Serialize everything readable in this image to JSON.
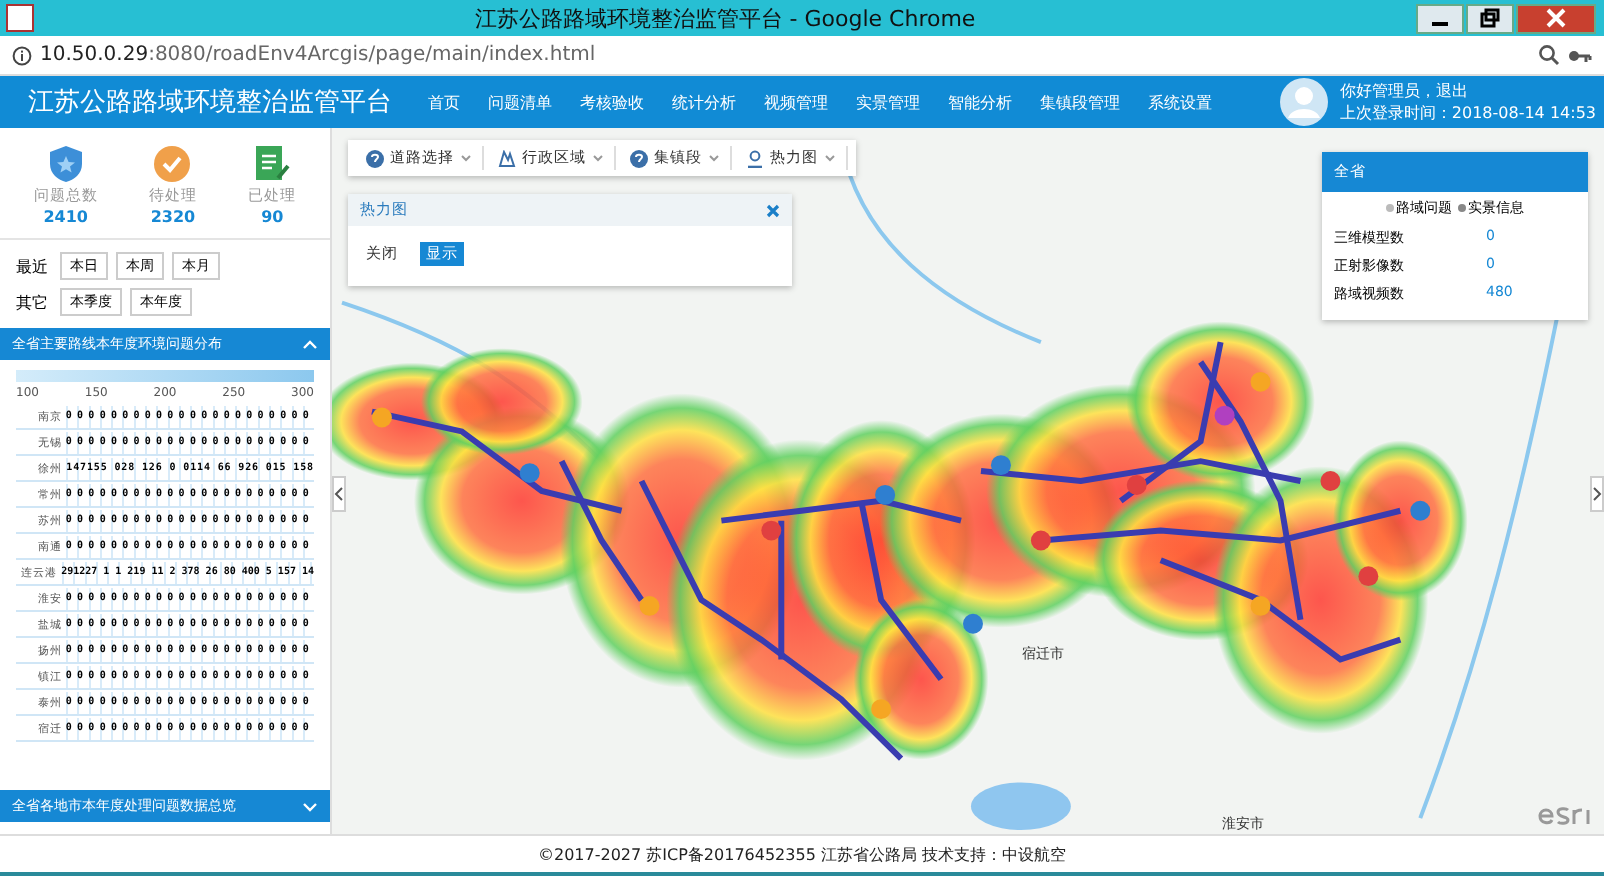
{
  "window": {
    "title": "江苏公路路域环境整治监管平台 - Google Chrome"
  },
  "address_bar": {
    "host": "10.50.0.29",
    "path": ":8080/roadEnv4Arcgis/page/main/index.html"
  },
  "header": {
    "title": "江苏公路路域环境整治监管平台",
    "nav": [
      {
        "label": "首页"
      },
      {
        "label": "问题清单"
      },
      {
        "label": "考核验收"
      },
      {
        "label": "统计分析"
      },
      {
        "label": "视频管理"
      },
      {
        "label": "实景管理"
      },
      {
        "label": "智能分析"
      },
      {
        "label": "集镇段管理"
      },
      {
        "label": "系统设置"
      }
    ],
    "greeting": "你好管理员，退出",
    "last_login": "上次登录时间：2018-08-14 14:53"
  },
  "stats": [
    {
      "kind": "total",
      "label": "问题总数",
      "value": "2410"
    },
    {
      "kind": "pending",
      "label": "待处理",
      "value": "2320"
    },
    {
      "kind": "done",
      "label": "已处理",
      "value": "90"
    }
  ],
  "filters": [
    {
      "label": "最近",
      "options": [
        "本日",
        "本周",
        "本月"
      ]
    },
    {
      "label": "其它",
      "options": [
        "本季度",
        "本年度"
      ]
    }
  ],
  "section_1": {
    "title": "全省主要路线本年度环境问题分布",
    "expanded": true
  },
  "matrix": {
    "axis": [
      "100",
      "150",
      "200",
      "250",
      "300"
    ],
    "rows": [
      {
        "name": "南京",
        "values": "0000000000000000000000"
      },
      {
        "name": "无锡",
        "values": "0000000000000000000000"
      },
      {
        "name": "徐州",
        "values": "147155 028 126 0 0114 66 926 015 158"
      },
      {
        "name": "常州",
        "values": "0000000000000000000000"
      },
      {
        "name": "苏州",
        "values": "0000000000000000000000"
      },
      {
        "name": "南通",
        "values": "0000000000000000000000"
      },
      {
        "name": "连云港",
        "values": "291227 1 1 219 11 2 378 26 80 400 5 157 14"
      },
      {
        "name": "淮安",
        "values": "0000000000000000000000"
      },
      {
        "name": "盐城",
        "values": "0000000000000000000000"
      },
      {
        "name": "扬州",
        "values": "0000000000000000000000"
      },
      {
        "name": "镇江",
        "values": "0000000000000000000000"
      },
      {
        "name": "泰州",
        "values": "0000000000000000000000"
      },
      {
        "name": "宿迁",
        "values": "0000000000000000000000"
      }
    ]
  },
  "section_2": {
    "title": "全省各地市本年度处理问题数据总览",
    "expanded": false
  },
  "map": {
    "toolbar": [
      {
        "kind": "help",
        "label": "道路选择"
      },
      {
        "kind": "region",
        "label": "行政区域"
      },
      {
        "kind": "help",
        "label": "集镇段"
      },
      {
        "kind": "person",
        "label": "热力图"
      }
    ],
    "heat_panel": {
      "title": "热力图",
      "options": [
        {
          "label": "关闭",
          "selected": false
        },
        {
          "label": "显示",
          "selected": true
        }
      ]
    },
    "info_card": {
      "title": "全省",
      "legend": [
        {
          "label": "路域问题",
          "color": "#bbbbbb"
        },
        {
          "label": "实景信息",
          "color": "#888888"
        }
      ],
      "rows": [
        {
          "label": "三维模型数",
          "value": "0"
        },
        {
          "label": "正射影像数",
          "value": "0"
        },
        {
          "label": "路域视频数",
          "value": "480"
        }
      ]
    },
    "labels": [
      "宿迁市",
      "淮安市"
    ]
  },
  "footer": "©2017-2027 苏ICP备20176452355 江苏省公路局 技术支持：中设航空"
}
